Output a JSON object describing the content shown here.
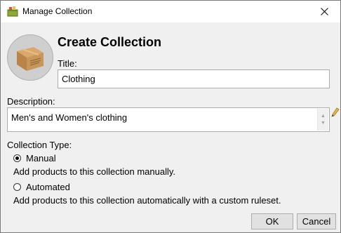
{
  "window": {
    "title": "Manage Collection",
    "icon": "collection-app-icon",
    "close_icon": "close-icon"
  },
  "header": {
    "heading": "Create Collection",
    "image": "cardboard-box-image"
  },
  "form": {
    "title_label": "Title:",
    "title_value": "Clothing",
    "description_label": "Description:",
    "description_value": "Men's and Women's clothing",
    "edit_icon": "pencil-icon",
    "type_label": "Collection Type:",
    "options": [
      {
        "label": "Manual",
        "description": "Add products to this collection manually.",
        "selected": true
      },
      {
        "label": "Automated",
        "description": "Add products to this collection automatically with a custom ruleset.",
        "selected": false
      }
    ]
  },
  "buttons": {
    "ok": "OK",
    "cancel": "Cancel"
  }
}
